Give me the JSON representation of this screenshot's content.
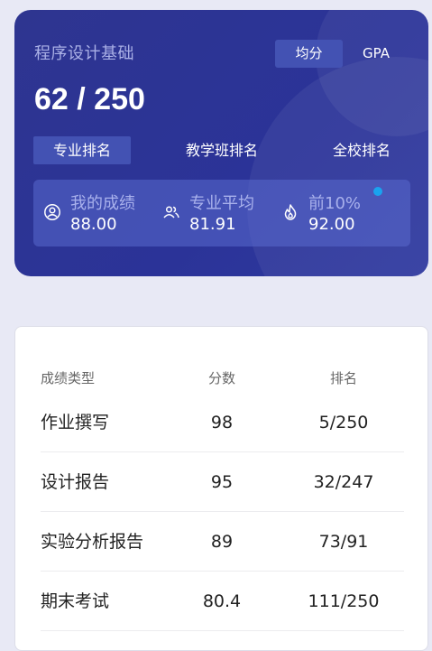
{
  "header": {
    "course_name": "程序设计基础",
    "rank_display": "62 / 250",
    "toggle": {
      "avg_label": "均分",
      "gpa_label": "GPA",
      "selected": "均分"
    },
    "rank_tabs": [
      "专业排名",
      "教学班排名",
      "全校排名"
    ],
    "stats": [
      {
        "label": "我的成绩",
        "value": "88.00",
        "icon": "user-icon"
      },
      {
        "label": "专业平均",
        "value": "81.91",
        "icon": "group-icon"
      },
      {
        "label": "前10%",
        "value": "92.00",
        "icon": "flame-icon"
      }
    ],
    "colors": {
      "card": "#2b3398",
      "accent": "#4352b3",
      "dot": "#1aa3ef"
    }
  },
  "table": {
    "headers": [
      "成绩类型",
      "分数",
      "排名"
    ],
    "rows": [
      {
        "type": "作业撰写",
        "score": "98",
        "rank": "5/250"
      },
      {
        "type": "设计报告",
        "score": "95",
        "rank": "32/247"
      },
      {
        "type": "实验分析报告",
        "score": "89",
        "rank": "73/91"
      },
      {
        "type": "期末考试",
        "score": "80.4",
        "rank": "111/250"
      }
    ]
  }
}
